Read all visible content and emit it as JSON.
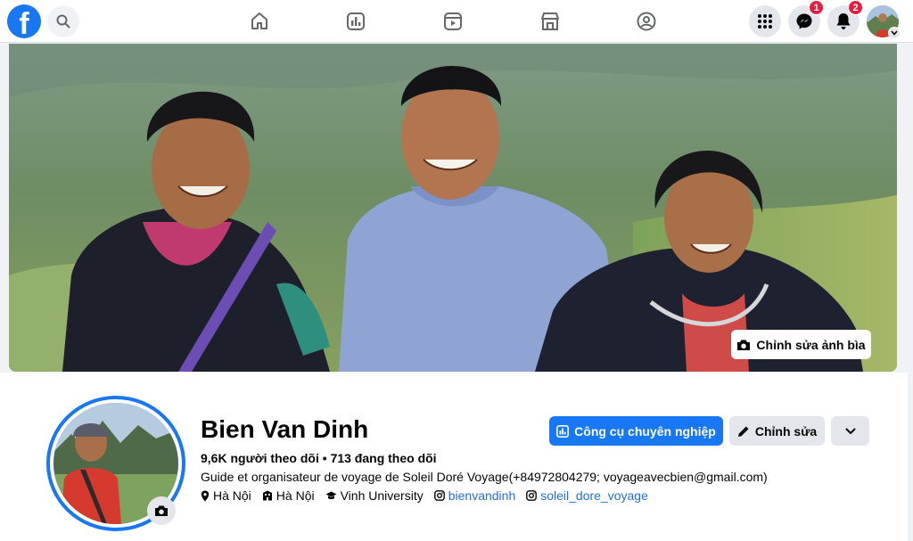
{
  "topbar": {
    "logo_letter": "f",
    "nav": [
      "home-icon",
      "dashboard-icon",
      "video-icon",
      "marketplace-icon",
      "groups-icon"
    ],
    "messenger_badge": "1",
    "notifications_badge": "2"
  },
  "cover": {
    "edit_label": "Chỉnh sửa ảnh bìa"
  },
  "profile": {
    "name": "Bien Van Dinh",
    "followers": "9,6K người theo dõi",
    "separator": "•",
    "following": "713 đang theo dõi",
    "bio": "Guide et organisateur de voyage de Soleil Doré Voyage(+84972804279; voyageavecbien@gmail.com)",
    "details": {
      "location": "Hà Nội",
      "hometown": "Hà Nội",
      "education": "Vinh University",
      "instagram1": "bienvandinh",
      "instagram2": "soleil_dore_voyage"
    }
  },
  "actions": {
    "pro_tools": "Công cụ chuyên nghiệp",
    "edit": "Chỉnh sửa"
  },
  "colors": {
    "brand": "#1877f2",
    "badge": "#e41e3f",
    "link": "#216fdb"
  }
}
